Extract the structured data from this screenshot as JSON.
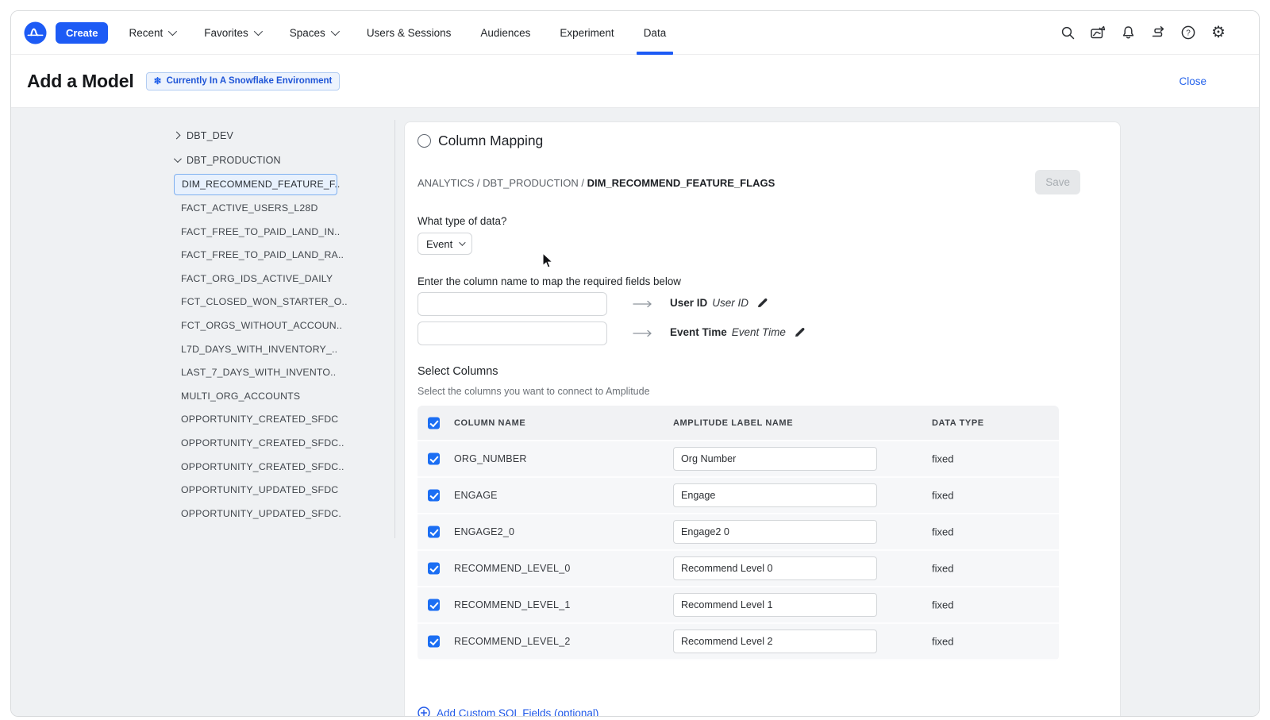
{
  "nav": {
    "create_label": "Create",
    "items": [
      {
        "label": "Recent",
        "has_chevron": true
      },
      {
        "label": "Favorites",
        "has_chevron": true
      },
      {
        "label": "Spaces",
        "has_chevron": true
      },
      {
        "label": "Users & Sessions",
        "has_chevron": false
      },
      {
        "label": "Audiences",
        "has_chevron": false
      },
      {
        "label": "Experiment",
        "has_chevron": false
      },
      {
        "label": "Data",
        "has_chevron": false,
        "active": true
      }
    ],
    "right_icons": [
      "search-icon",
      "chart-icon",
      "bell-icon",
      "connections-icon",
      "help-icon",
      "settings-icon"
    ]
  },
  "header": {
    "title": "Add a Model",
    "badge": "Currently In A Snowflake Environment",
    "badge_icon": "snowflake-icon",
    "close_label": "Close"
  },
  "sidebar": {
    "groups": [
      {
        "label": "DBT_DEV",
        "expanded": false
      },
      {
        "label": "DBT_PRODUCTION",
        "expanded": true
      }
    ],
    "items": [
      {
        "label": "DIM_RECOMMEND_FEATURE_F..",
        "selected": true
      },
      {
        "label": "FACT_ACTIVE_USERS_L28D",
        "selected": false
      },
      {
        "label": "FACT_FREE_TO_PAID_LAND_IN..",
        "selected": false
      },
      {
        "label": "FACT_FREE_TO_PAID_LAND_RA..",
        "selected": false
      },
      {
        "label": "FACT_ORG_IDS_ACTIVE_DAILY",
        "selected": false
      },
      {
        "label": "FCT_CLOSED_WON_STARTER_O..",
        "selected": false
      },
      {
        "label": "FCT_ORGS_WITHOUT_ACCOUN..",
        "selected": false
      },
      {
        "label": "L7D_DAYS_WITH_INVENTORY_..",
        "selected": false
      },
      {
        "label": "LAST_7_DAYS_WITH_INVENTO..",
        "selected": false
      },
      {
        "label": "MULTI_ORG_ACCOUNTS",
        "selected": false
      },
      {
        "label": "OPPORTUNITY_CREATED_SFDC",
        "selected": false
      },
      {
        "label": "OPPORTUNITY_CREATED_SFDC..",
        "selected": false
      },
      {
        "label": "OPPORTUNITY_CREATED_SFDC..",
        "selected": false
      },
      {
        "label": "OPPORTUNITY_UPDATED_SFDC",
        "selected": false
      },
      {
        "label": "OPPORTUNITY_UPDATED_SFDC.",
        "selected": false
      }
    ]
  },
  "main": {
    "section_title": "Column Mapping",
    "breadcrumb": {
      "prefix": "ANALYTICS / DBT_PRODUCTION / ",
      "current": "DIM_RECOMMEND_FEATURE_FLAGS"
    },
    "save_label": "Save",
    "data_type_question": "What type of data?",
    "data_type_value": "Event",
    "mapping_instruction": "Enter the column name to map the required fields below",
    "mappings": [
      {
        "input_value": "",
        "field": "User ID",
        "field_hint": "User ID"
      },
      {
        "input_value": "",
        "field": "Event Time",
        "field_hint": "Event Time"
      }
    ],
    "select_columns_title": "Select Columns",
    "select_columns_subtitle": "Select the columns you want to connect to Amplitude",
    "table": {
      "select_all_checked": true,
      "headers": [
        "COLUMN NAME",
        "AMPLITUDE LABEL NAME",
        "DATA TYPE"
      ],
      "rows": [
        {
          "checked": true,
          "column_name": "ORG_NUMBER",
          "label": "Org Number",
          "data_type": "fixed"
        },
        {
          "checked": true,
          "column_name": "ENGAGE",
          "label": "Engage",
          "data_type": "fixed"
        },
        {
          "checked": true,
          "column_name": "ENGAGE2_0",
          "label": "Engage2 0",
          "data_type": "fixed"
        },
        {
          "checked": true,
          "column_name": "RECOMMEND_LEVEL_0",
          "label": "Recommend Level 0",
          "data_type": "fixed"
        },
        {
          "checked": true,
          "column_name": "RECOMMEND_LEVEL_1",
          "label": "Recommend Level 1",
          "data_type": "fixed"
        },
        {
          "checked": true,
          "column_name": "RECOMMEND_LEVEL_2",
          "label": "Recommend Level 2",
          "data_type": "fixed"
        }
      ]
    },
    "add_custom_sql_label": "Add Custom SQL Fields (optional)"
  },
  "colors": {
    "accent": "#1d5bf5",
    "badge_bg": "#edf3fd",
    "badge_border": "#b3cdf2",
    "badge_text": "#1f55d7",
    "body_bg": "#eff1f3",
    "selected_item_bg": "#e8f1fd",
    "selected_item_border": "#7fb0ef",
    "checkbox_blue": "#1b6ef3",
    "link_blue": "#2563eb",
    "table_header_bg": "#f1f2f4",
    "table_row_bg": "#f6f7f9"
  }
}
